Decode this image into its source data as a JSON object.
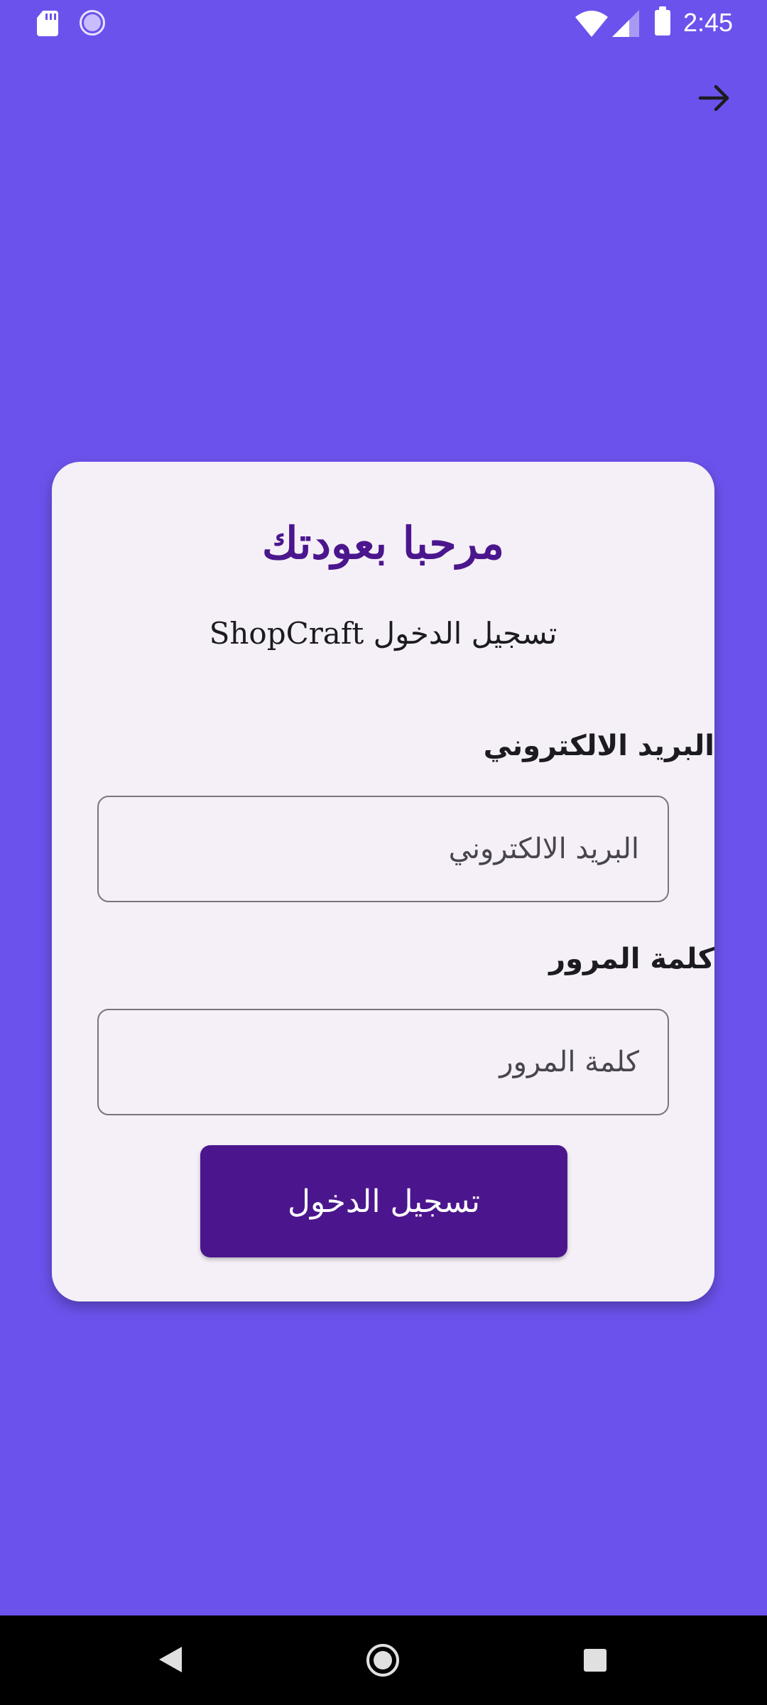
{
  "status_bar": {
    "time": "2:45",
    "icons": [
      "sd-card-icon",
      "sync-icon",
      "wifi-icon",
      "signal-icon",
      "battery-icon"
    ]
  },
  "top_bar": {
    "action_icon": "arrow-forward-icon"
  },
  "login_card": {
    "title": "مرحبا بعودتك",
    "subtitle": "تسجيل الدخول ShopCraft",
    "email_label": "البريد الالكتروني",
    "email_placeholder": "البريد الالكتروني",
    "email_value": "",
    "password_label": "كلمة المرور",
    "password_placeholder": "كلمة المرور",
    "password_value": "",
    "login_button_label": "تسجيل الدخول"
  },
  "nav_bar": {
    "icons": [
      "back-icon",
      "home-icon",
      "recents-icon"
    ]
  },
  "colors": {
    "background": "#6c52ec",
    "card": "#f5f0f7",
    "accent": "#4b168d",
    "field_border": "#79747e"
  }
}
